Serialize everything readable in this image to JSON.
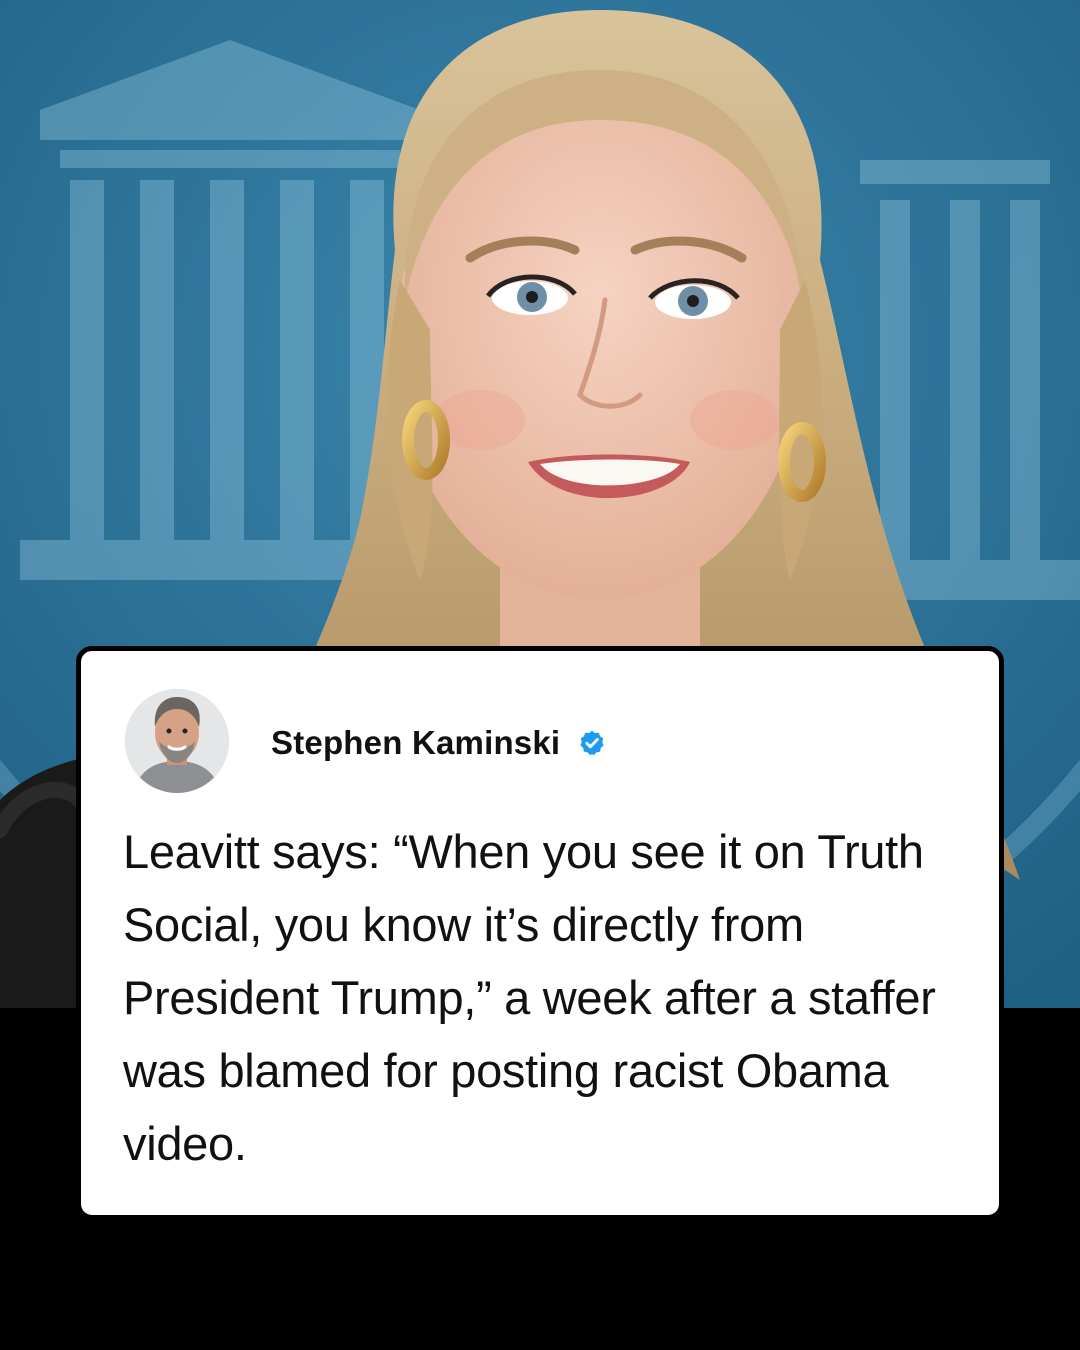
{
  "post": {
    "author_name": "Stephen Kaminski",
    "verified": true,
    "text": "Leavitt says: “When you see it on Truth Social, you know it’s directly from President Trump,” a week after a staffer was blamed for posting racist Obama video."
  },
  "icons": {
    "verified": "verified-badge-icon"
  },
  "colors": {
    "background": "#000000",
    "card": "#ffffff",
    "text": "#111111",
    "verified_badge": "#1d9bf0",
    "photo_backdrop": "#2a6f94"
  }
}
